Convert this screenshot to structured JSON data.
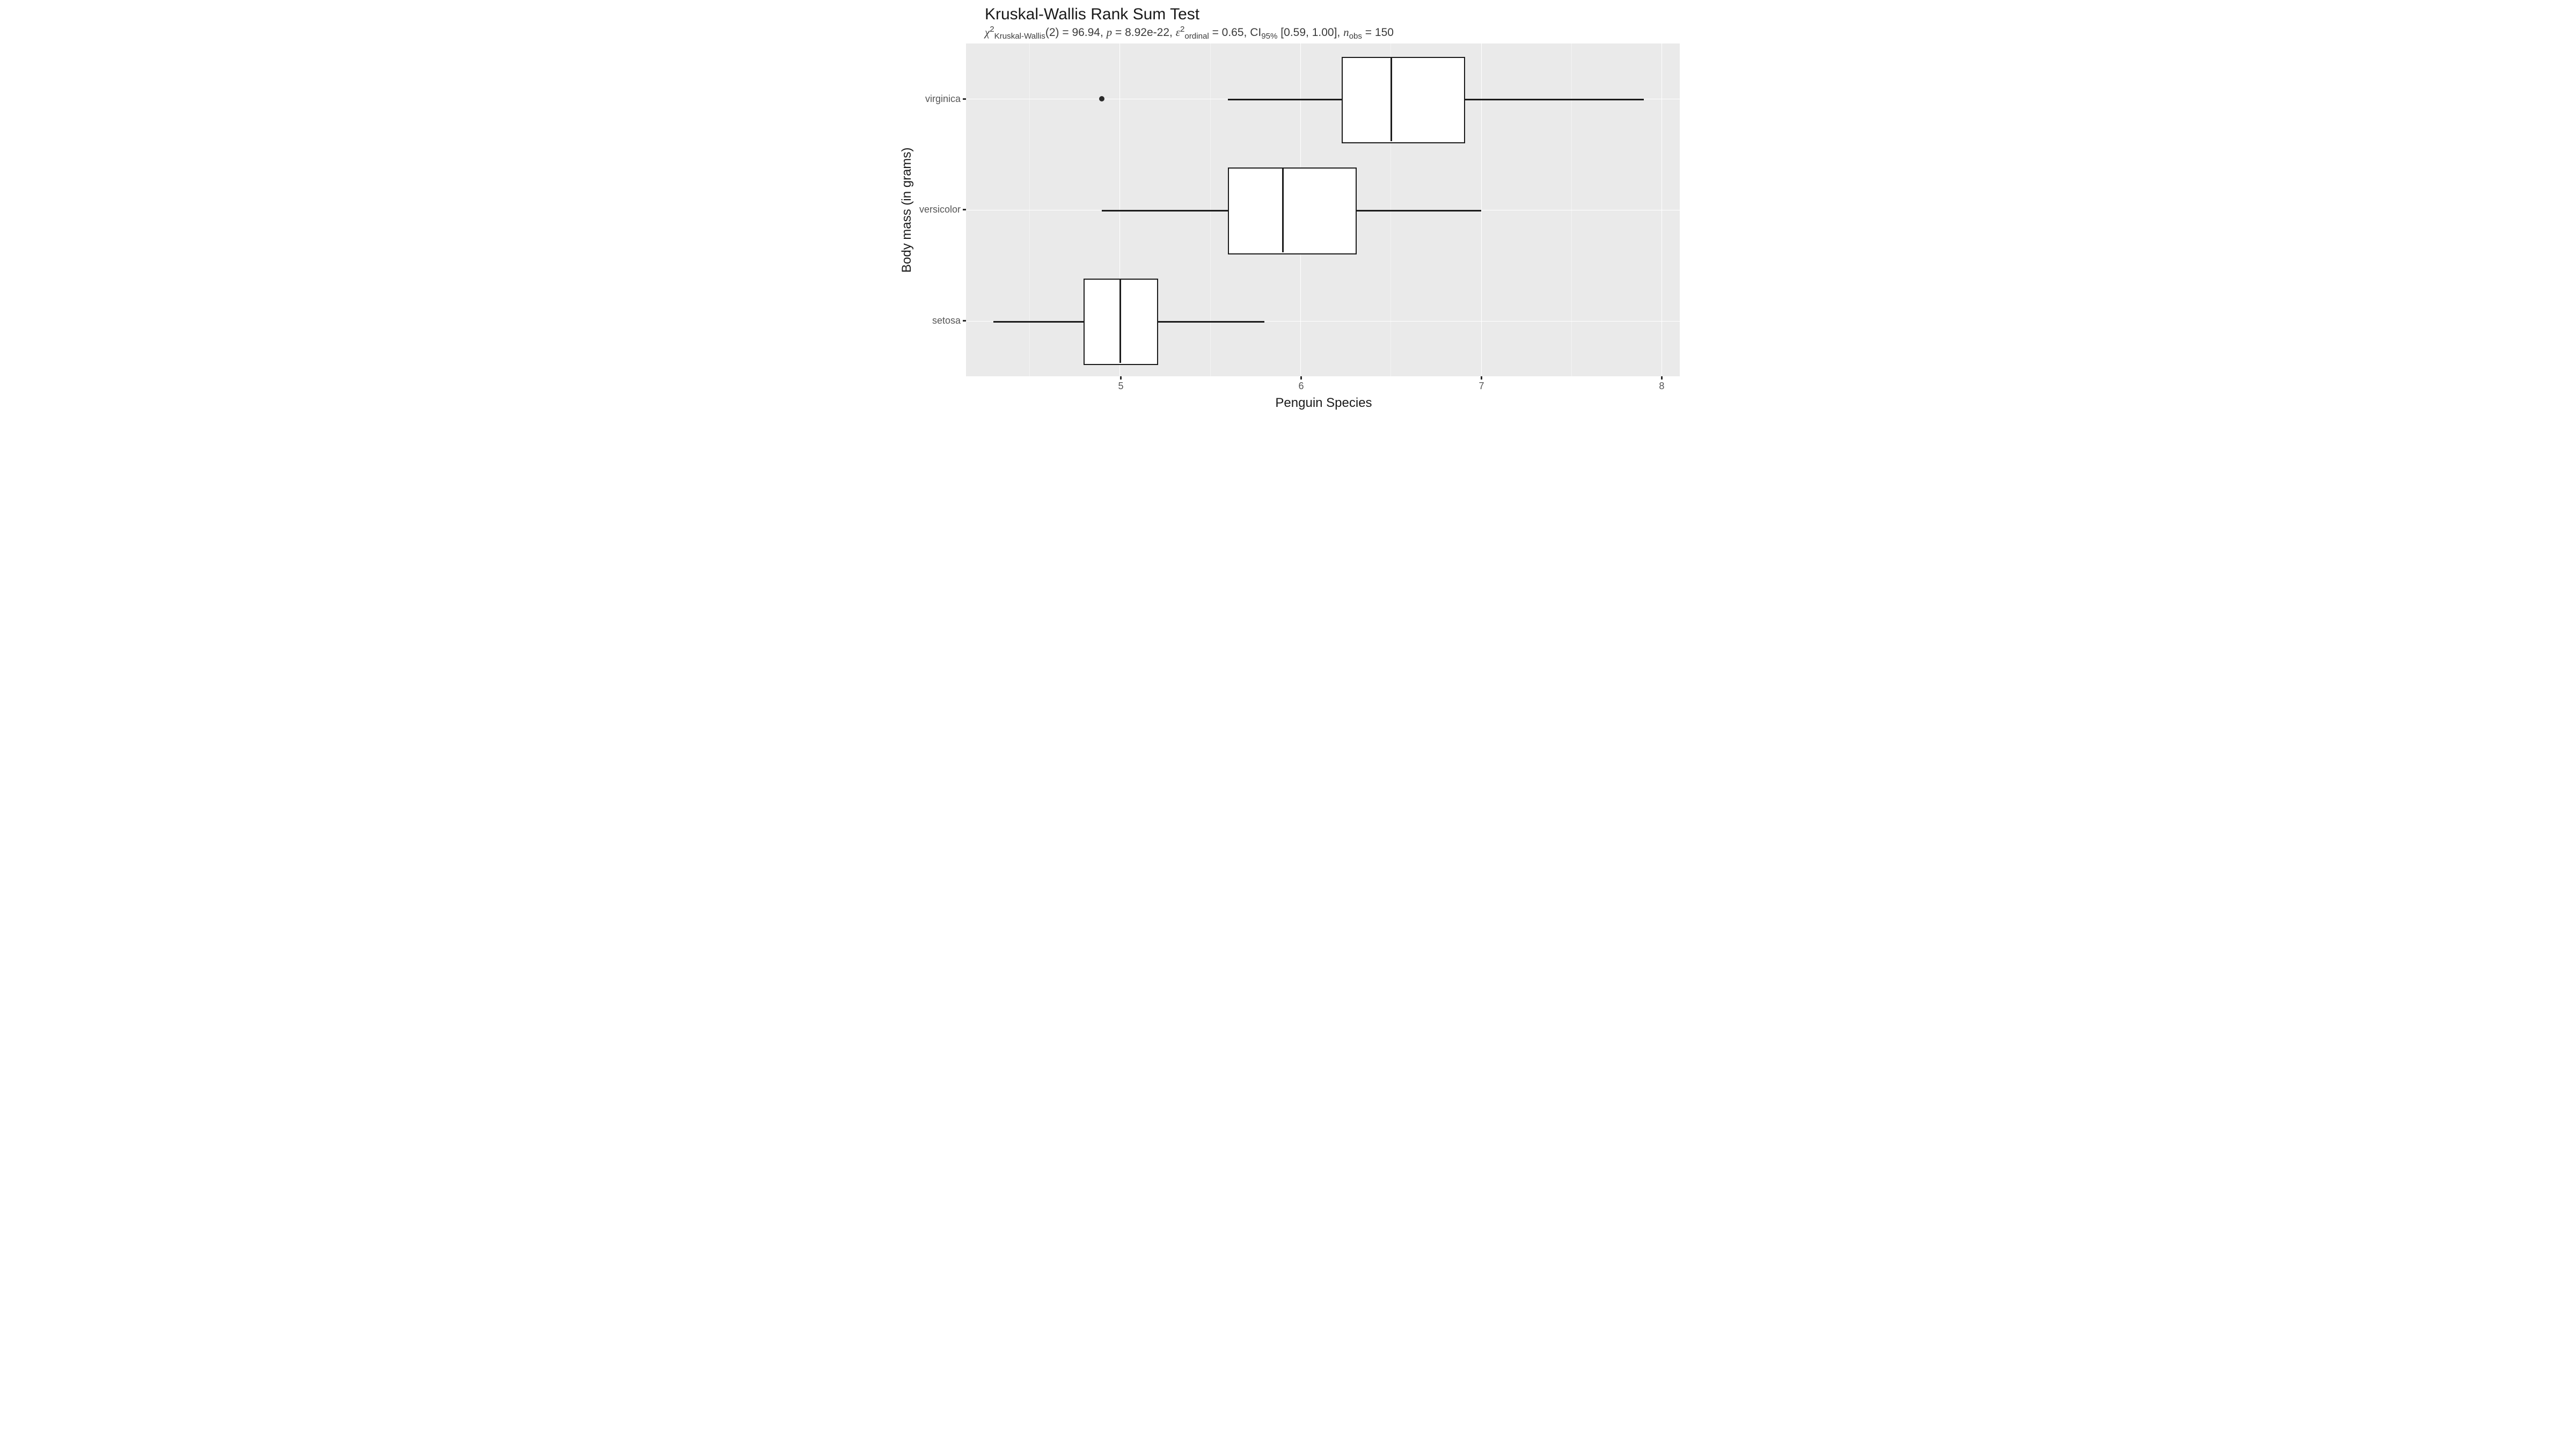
{
  "title": "Kruskal-Wallis Rank Sum Test",
  "subtitle": {
    "df": "2",
    "chi2": "96.94",
    "p": "8.92e-22",
    "epsilon2": "0.65",
    "ci_label": "95%",
    "ci_lo": "0.59",
    "ci_hi": "1.00",
    "n_obs": "150"
  },
  "axes": {
    "x_title": "Penguin Species",
    "y_title": "Body mass (in grams)",
    "x_ticks": [
      {
        "value": 5,
        "label": "5"
      },
      {
        "value": 6,
        "label": "6"
      },
      {
        "value": 7,
        "label": "7"
      },
      {
        "value": 8,
        "label": "8"
      }
    ],
    "y_categories": [
      "virginica",
      "versicolor",
      "setosa"
    ],
    "x_range": [
      4.15,
      8.1
    ]
  },
  "chart_data": {
    "type": "boxplot_horizontal",
    "title": "Kruskal-Wallis Rank Sum Test",
    "xlabel": "Penguin Species",
    "ylabel": "Body mass (in grams)",
    "xlim": [
      4.15,
      8.1
    ],
    "data": [
      {
        "category": "setosa",
        "whisker_lo": 4.3,
        "q1": 4.8,
        "median": 5.0,
        "q3": 5.2,
        "whisker_hi": 5.8,
        "outliers": []
      },
      {
        "category": "versicolor",
        "whisker_lo": 4.9,
        "q1": 5.6,
        "median": 5.9,
        "q3": 6.3,
        "whisker_hi": 7.0,
        "outliers": []
      },
      {
        "category": "virginica",
        "whisker_lo": 5.6,
        "q1": 6.23,
        "median": 6.5,
        "q3": 6.9,
        "whisker_hi": 7.9,
        "outliers": [
          4.9
        ]
      }
    ],
    "stats": {
      "chi2_kw": 96.94,
      "df": 2,
      "p": 8.92e-22,
      "epsilon2_ordinal": 0.65,
      "ci95": [
        0.59,
        1.0
      ],
      "n_obs": 150
    }
  }
}
